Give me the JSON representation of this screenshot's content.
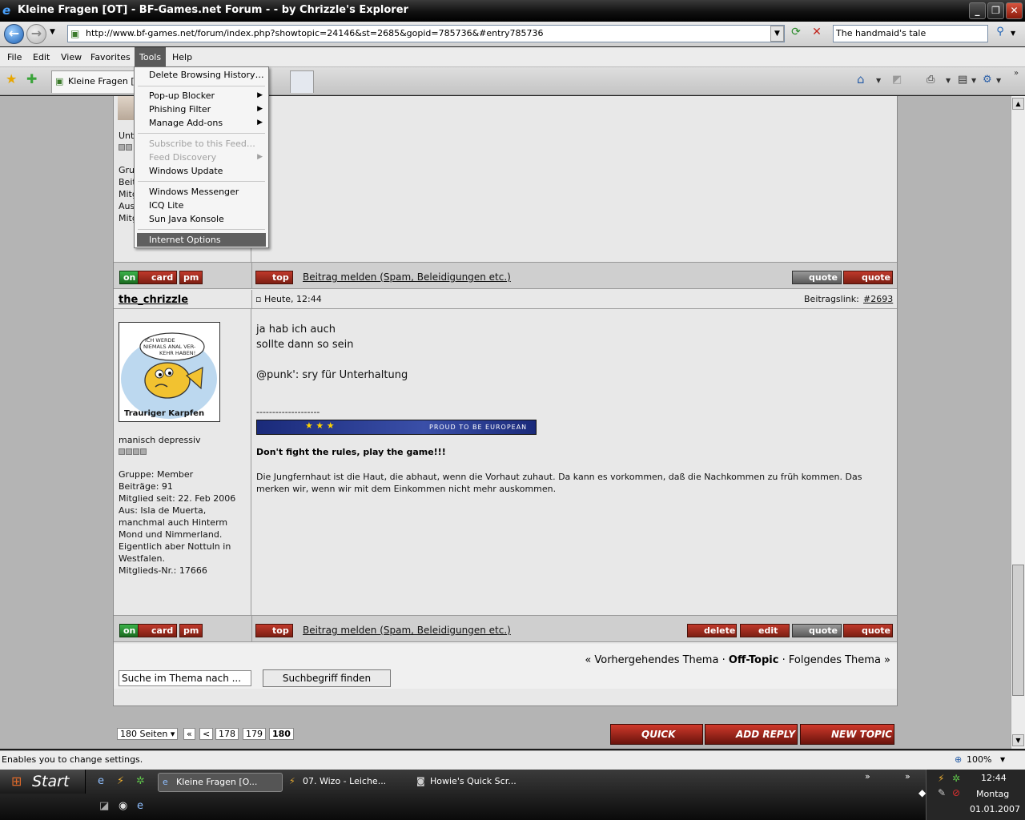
{
  "window": {
    "title": "Kleine Fragen [OT] - BF-Games.net Forum -  - by Chrizzle's Explorer",
    "buttons": {
      "minimize": "_",
      "maximize": "❐",
      "close": "✕"
    }
  },
  "address": {
    "url": "http://www.bf-games.net/forum/index.php?showtopic=24146&st=2685&gopid=785736&#entry785736",
    "search": "The handmaid's tale"
  },
  "menu": {
    "items": [
      "File",
      "Edit",
      "View",
      "Favorites",
      "Tools",
      "Help"
    ]
  },
  "tabs": {
    "active": "Kleine Fragen [O..."
  },
  "tools_menu": {
    "items": [
      {
        "label": "Delete Browsing History…",
        "state": "normal",
        "arrow": ""
      },
      {
        "label": "Pop-up Blocker",
        "state": "normal",
        "arrow": "▶"
      },
      {
        "label": "Phishing Filter",
        "state": "normal",
        "arrow": "▶"
      },
      {
        "label": "Manage Add-ons",
        "state": "normal",
        "arrow": "▶"
      },
      {
        "label": "Subscribe to this Feed…",
        "state": "disabled",
        "arrow": ""
      },
      {
        "label": "Feed Discovery",
        "state": "disabled",
        "arrow": "▶"
      },
      {
        "label": "Windows Update",
        "state": "normal",
        "arrow": ""
      },
      {
        "label": "Windows Messenger",
        "state": "normal",
        "arrow": ""
      },
      {
        "label": "ICQ Lite",
        "state": "normal",
        "arrow": ""
      },
      {
        "label": "Sun Java Konsole",
        "state": "normal",
        "arrow": ""
      },
      {
        "label": "Internet Options",
        "state": "selected",
        "arrow": ""
      }
    ]
  },
  "prev_post": {
    "sidebar_fragments": [
      "Unt",
      "Gru",
      "Beit",
      "Mitg",
      "Aus",
      "Mitg"
    ]
  },
  "bar_buttons": {
    "on": "on",
    "card": "card",
    "pm": "pm",
    "top": "top",
    "report": "Beitrag melden (Spam, Beleidigungen etc.)",
    "add_quote": "quote",
    "quote": "quote",
    "delete": "delete",
    "edit": "edit"
  },
  "post": {
    "author": "the_chrizzle",
    "date": "Heute, 12:44",
    "link_label": "Beitragslink:",
    "link_value": "#2693",
    "avatar_caption": "Trauriger Karpfen",
    "avatar_bubble": "ICH WERDE NIEMALS ANAL VER-KEHR HABEN!",
    "user_title": "manisch depressiv",
    "group": "Gruppe: Member",
    "posts": "Beiträge: 91",
    "member_since": "Mitglied seit: 22. Feb 2006",
    "from_1": "Aus: Isla de Muerta,",
    "from_2": "manchmal auch Hinterm",
    "from_3": "Mond und Nimmerland.",
    "from_4": "Eigentlich aber Nottuln in",
    "from_5": "Westfalen.",
    "member_no": "Mitglieds-Nr.: 17666",
    "line1": "ja hab ich auch",
    "line2": "sollte dann so sein",
    "line3": "@punk': sry für Unterhaltung",
    "sig_sep": "--------------------",
    "banner": "PROUD TO BE EUROPEAN",
    "sig_bold": "Don't fight the rules, play the game!!!",
    "sig_text": "Die Jungfernhaut ist die Haut, die abhaut, wenn die Vorhaut zuhaut. Da kann es vorkommen, daß die Nachkommen zu früh kommen. Das merken wir, wenn wir mit dem Einkommen nicht mehr auskommen."
  },
  "thread_nav": {
    "prev": "« Vorhergehendes Thema",
    "sep": "·",
    "current": "Off-Topic",
    "next": "Folgendes Thema »"
  },
  "search": {
    "value": "Suche im Thema nach ...",
    "button": "Suchbegriff finden"
  },
  "pagination": {
    "pages_label": "180 Seiten ▾",
    "first": "«",
    "prev": "<",
    "pages": [
      "178",
      "179",
      "180"
    ]
  },
  "big_buttons": {
    "quick_reply": "QUICK REPLY",
    "add_reply": "ADD REPLY",
    "new_topic": "NEW TOPIC"
  },
  "status": {
    "text": "Enables you to change settings.",
    "zoom": "100%"
  },
  "taskbar": {
    "start": "Start",
    "tasks": [
      "Kleine Fragen [O...",
      "07. Wizo - Leiche...",
      "Howie's Quick Scr..."
    ],
    "time": "12:44",
    "day": "Montag",
    "date": "01.01.2007"
  }
}
